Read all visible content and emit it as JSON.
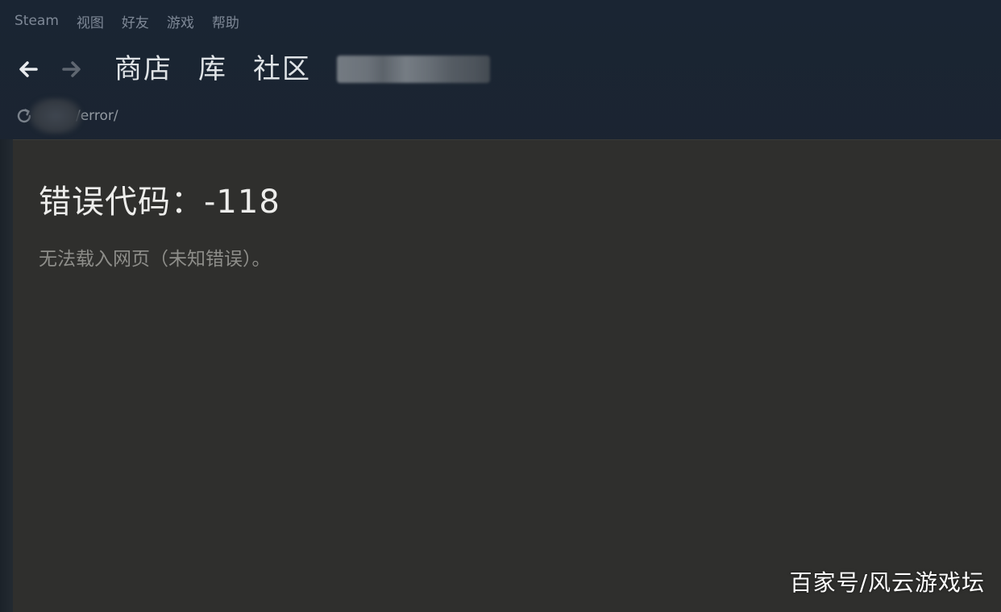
{
  "menubar": {
    "items": [
      {
        "label": "Steam"
      },
      {
        "label": "视图"
      },
      {
        "label": "好友"
      },
      {
        "label": "游戏"
      },
      {
        "label": "帮助"
      }
    ]
  },
  "navbar": {
    "back_icon": "arrow-left-icon",
    "forward_icon": "arrow-right-icon",
    "tabs": [
      {
        "label": "商店"
      },
      {
        "label": "库"
      },
      {
        "label": "社区"
      }
    ]
  },
  "urlbar": {
    "reload_icon": "reload-icon",
    "url_suffix": "/error/"
  },
  "page": {
    "error_title": "错误代码：-118",
    "error_message": "无法载入网页（未知错误）。"
  },
  "watermark": {
    "text": "百家号/风云游戏坛"
  },
  "colors": {
    "background_top": "#1a2533",
    "content_bg": "#2f2f2d",
    "nav_text": "#dfe3e6",
    "menu_text": "#7e8896",
    "error_title": "#ededeb",
    "error_message": "#8e8e8a"
  }
}
